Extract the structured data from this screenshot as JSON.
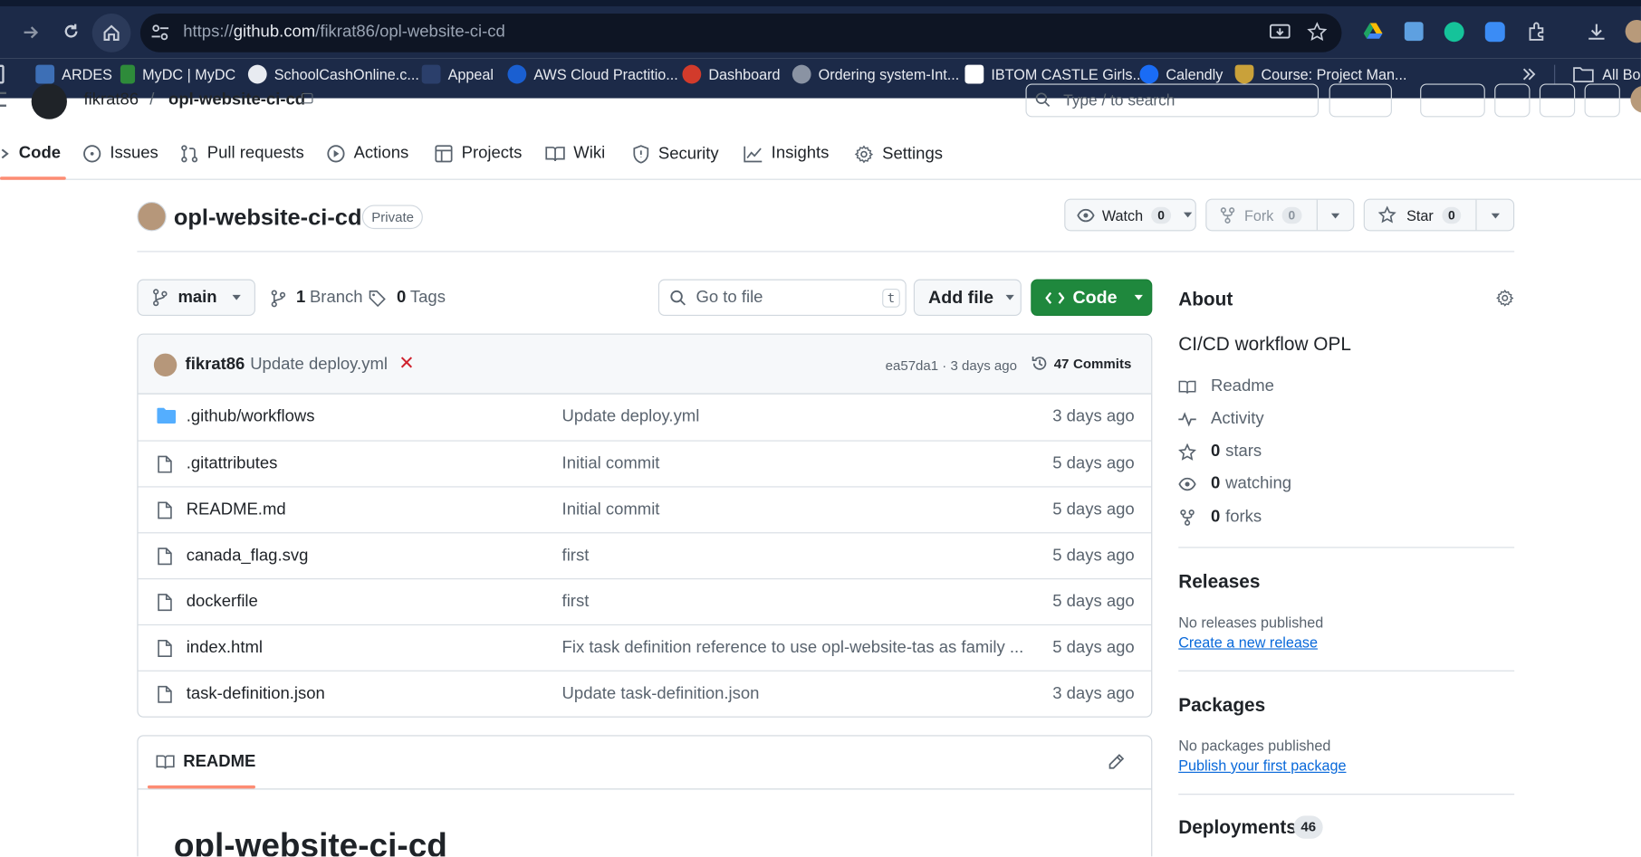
{
  "browser": {
    "url_prefix": "https://",
    "url_host": "github.com",
    "url_path": "/fikrat86/opl-website-ci-cd",
    "bookmarks": [
      {
        "label": "ARDES",
        "color": "#3d6fb6"
      },
      {
        "label": "MyDC | MyDC",
        "color": "#2e8b3a"
      },
      {
        "label": "SchoolCashOnline.c...",
        "color": "#e8ebf1"
      },
      {
        "label": "Appeal",
        "color": "#2b3f6b"
      },
      {
        "label": "AWS Cloud Practitio...",
        "color": "#1a5fd1"
      },
      {
        "label": "Dashboard",
        "color": "#d23b2b"
      },
      {
        "label": "Ordering system-Int...",
        "color": "#8a93a3"
      },
      {
        "label": "IBTOM CASTLE Girls...",
        "color": "#ffffff"
      },
      {
        "label": "Calendly",
        "color": "#1a6cf5"
      },
      {
        "label": "Course: Project Man...",
        "color": "#c9a13a"
      }
    ],
    "all_bookmarks": "All Boo"
  },
  "repo_header": {
    "owner": "fikrat86",
    "repo": "opl-website-ci-cd",
    "search_placeholder": "Type / to search"
  },
  "tabs": [
    "Code",
    "Issues",
    "Pull requests",
    "Actions",
    "Projects",
    "Wiki",
    "Security",
    "Insights",
    "Settings"
  ],
  "repo": {
    "title": "opl-website-ci-cd",
    "visibility": "Private",
    "watch_label": "Watch",
    "watch_count": "0",
    "fork_label": "Fork",
    "fork_count": "0",
    "star_label": "Star",
    "star_count": "0"
  },
  "toolbar": {
    "branch": "main",
    "branches_count": "1",
    "branches_label": "Branch",
    "tags_count": "0",
    "tags_label": "Tags",
    "go_to_file": "Go to file",
    "go_to_file_key": "t",
    "add_file": "Add file",
    "code": "Code"
  },
  "commit": {
    "author": "fikrat86",
    "message": "Update deploy.yml",
    "status": "✕",
    "hash_time": "ea57da1 · 3 days ago",
    "commits_count": "47",
    "commits_label": "Commits"
  },
  "files": [
    {
      "name": ".github/workflows",
      "type": "folder",
      "message": "Update deploy.yml",
      "age": "3 days ago"
    },
    {
      "name": ".gitattributes",
      "type": "file",
      "message": "Initial commit",
      "age": "5 days ago"
    },
    {
      "name": "README.md",
      "type": "file",
      "message": "Initial commit",
      "age": "5 days ago"
    },
    {
      "name": "canada_flag.svg",
      "type": "file",
      "message": "first",
      "age": "5 days ago"
    },
    {
      "name": "dockerfile",
      "type": "file",
      "message": "first",
      "age": "5 days ago"
    },
    {
      "name": "index.html",
      "type": "file",
      "message": "Fix task definition reference to use opl-website-tas as family ...",
      "age": "5 days ago"
    },
    {
      "name": "task-definition.json",
      "type": "file",
      "message": "Update task-definition.json",
      "age": "3 days ago"
    }
  ],
  "readme": {
    "tab_label": "README",
    "heading": "opl-website-ci-cd"
  },
  "about": {
    "title": "About",
    "description": "CI/CD workflow OPL",
    "readme": "Readme",
    "activity": "Activity",
    "stars_count": "0",
    "stars_label": "stars",
    "watching_count": "0",
    "watching_label": "watching",
    "forks_count": "0",
    "forks_label": "forks"
  },
  "releases": {
    "title": "Releases",
    "none": "No releases published",
    "link": "Create a new release"
  },
  "packages": {
    "title": "Packages",
    "none": "No packages published",
    "link": "Publish your first package"
  },
  "deployments": {
    "title": "Deployments",
    "count": "46"
  }
}
